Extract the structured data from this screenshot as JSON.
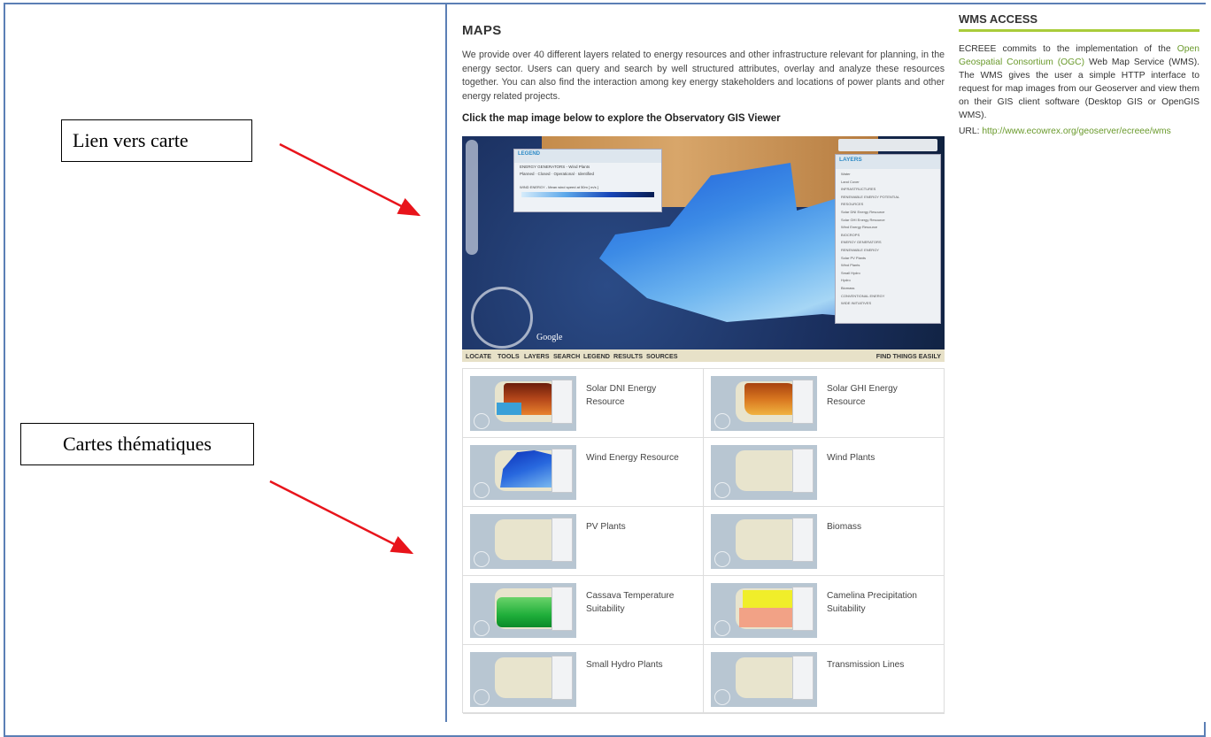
{
  "annotations": {
    "map_link": "Lien vers carte",
    "thematic_maps": "Cartes thématiques"
  },
  "maps": {
    "title": "MAPS",
    "description": "We provide over 40 different layers related to energy resources and other infrastructure relevant for planning, in the energy sector. Users can query and search by well structured attributes, overlay and analyze these resources together. You can also find the interaction among key energy stakeholders and locations of power plants and other energy related projects.",
    "cta": "Click the map image below to explore the Observatory GIS Viewer"
  },
  "viewer": {
    "legend_title": "LEGEND",
    "legend_subtitle": "ENERGY GENERATORS - Wind Plants",
    "legend_items": [
      "Planned",
      "Closed",
      "Operational",
      "Identified"
    ],
    "legend_scale_label": "WIND ENERGY - Mean wind speed at 50m [ m/s ]",
    "layers_title": "LAYERS",
    "layers_items": [
      "Water",
      "Land Cover",
      "INFRASTRUCTURES",
      "RENEWABLE ENERGY POTENTIAL",
      "RESOURCES",
      "Solar DNI Energy Resource",
      "Solar GHI Energy Resource",
      "Wind Energy Resource",
      "BIOCROPS",
      "ENERGY GENERATORS",
      "RENEWABLE ENERGY",
      "Solar PV Plants",
      "Wind Plants",
      "Small Hydro",
      "Hydro",
      "Biomass",
      "CONVENTIONAL ENERGY",
      "WIDE INITIATIVES"
    ],
    "google": "Google"
  },
  "navbar": {
    "items": [
      "LOCATE",
      "TOOLS",
      "LAYERS",
      "SEARCH",
      "LEGEND",
      "RESULTS",
      "SOURCES"
    ],
    "right": "FIND THINGS EASILY"
  },
  "thematic": [
    {
      "label": "Solar DNI Energy Resource",
      "kind": "dni"
    },
    {
      "label": "Solar GHI Energy Resource",
      "kind": "ghi"
    },
    {
      "label": "Wind Energy Resource",
      "kind": "wind"
    },
    {
      "label": "Wind Plants",
      "kind": "plain"
    },
    {
      "label": "PV Plants",
      "kind": "plain"
    },
    {
      "label": "Biomass",
      "kind": "plain"
    },
    {
      "label": "Cassava Temperature Suitability",
      "kind": "cassava"
    },
    {
      "label": "Camelina Precipitation Suitability",
      "kind": "camelina"
    },
    {
      "label": "Small Hydro Plants",
      "kind": "plain"
    },
    {
      "label": "Transmission Lines",
      "kind": "plain"
    }
  ],
  "wms": {
    "title": "WMS ACCESS",
    "text_before": "ECREEE commits to the implementation of the ",
    "ogc": "Open Geospatial Consortium (OGC)",
    "text_after": " Web Map Service (WMS). The WMS gives the user a simple HTTP interface to request for map images from our Geoserver and view them on their GIS client software (Desktop GIS or OpenGIS WMS).",
    "url_label": "URL: ",
    "url": "http://www.ecowrex.org/geoserver/ecreee/wms"
  },
  "colors": {
    "accent_green": "#a9cc3a",
    "link_green": "#6a9a2c",
    "arrow_red": "#e8141b",
    "frame_blue": "#5b7fb5"
  }
}
